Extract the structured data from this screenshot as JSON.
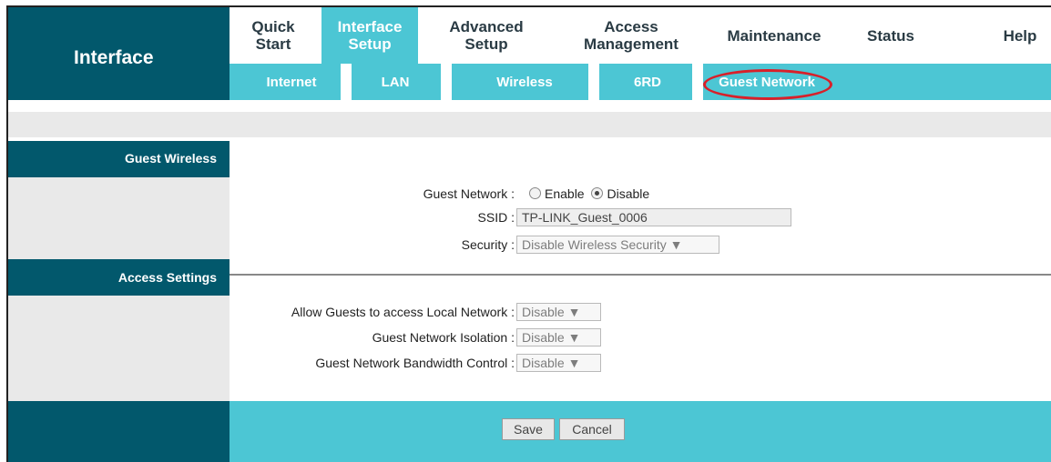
{
  "header": {
    "logo_title": "Interface"
  },
  "top_nav": {
    "items": [
      {
        "line1": "Quick",
        "line2": "Start"
      },
      {
        "line1": "Interface",
        "line2": "Setup"
      },
      {
        "line1": "Advanced",
        "line2": "Setup"
      },
      {
        "line1": "Access",
        "line2": "Management"
      },
      {
        "line1": "Maintenance",
        "line2": ""
      },
      {
        "line1": "Status",
        "line2": ""
      },
      {
        "line1": "Help",
        "line2": ""
      }
    ]
  },
  "sub_nav": {
    "items": [
      "Internet",
      "LAN",
      "Wireless",
      "6RD",
      "Guest Network"
    ]
  },
  "sections": {
    "guest_wireless": "Guest Wireless",
    "access_settings": "Access Settings"
  },
  "guest_wireless": {
    "guest_network_label": "Guest Network :",
    "enable_label": "Enable",
    "disable_label": "Disable",
    "selected": "Disable",
    "ssid_label": "SSID :",
    "ssid_value": "TP-LINK_Guest_0006",
    "security_label": "Security :",
    "security_value": "Disable Wireless Security ▼"
  },
  "access_settings": {
    "local_network_label": "Allow Guests to access Local Network :",
    "local_network_value": "Disable ▼",
    "isolation_label": "Guest Network Isolation :",
    "isolation_value": "Disable ▼",
    "bandwidth_label": "Guest Network Bandwidth Control :",
    "bandwidth_value": "Disable ▼"
  },
  "footer": {
    "save_label": "Save",
    "cancel_label": "Cancel"
  },
  "colors": {
    "dark_teal": "#02586c",
    "cyan": "#4cc6d4",
    "highlight_red": "#d8202a"
  }
}
